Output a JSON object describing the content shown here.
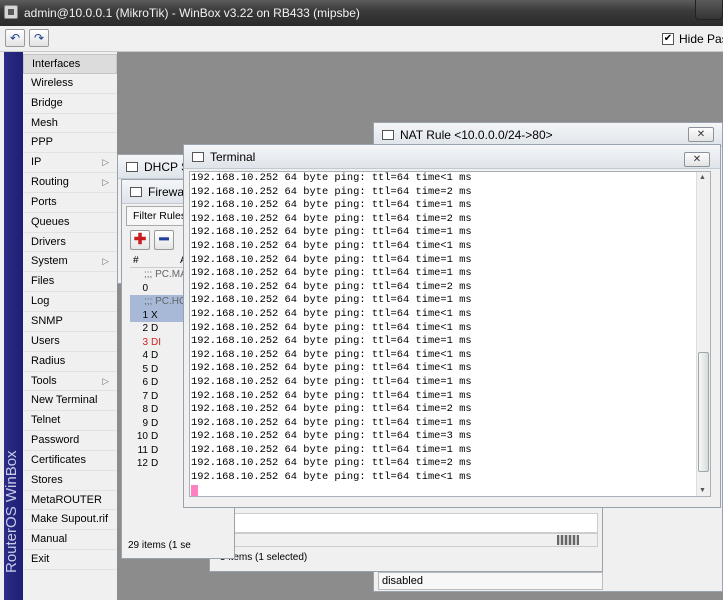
{
  "window": {
    "title": "admin@10.0.0.1 (MikroTik) - WinBox v3.22 on RB433 (mipsbe)"
  },
  "toolbar": {
    "undo_icon": "undo-icon",
    "redo_icon": "redo-icon",
    "hide_passwords_label": "Hide Passw",
    "hide_passwords_checked": true
  },
  "sidebar": {
    "brand": "RouterOS WinBox",
    "items": [
      {
        "label": "Interfaces",
        "submenu": false
      },
      {
        "label": "Wireless",
        "submenu": false
      },
      {
        "label": "Bridge",
        "submenu": false
      },
      {
        "label": "Mesh",
        "submenu": false
      },
      {
        "label": "PPP",
        "submenu": false
      },
      {
        "label": "IP",
        "submenu": true
      },
      {
        "label": "Routing",
        "submenu": true
      },
      {
        "label": "Ports",
        "submenu": false
      },
      {
        "label": "Queues",
        "submenu": false
      },
      {
        "label": "Drivers",
        "submenu": false
      },
      {
        "label": "System",
        "submenu": true
      },
      {
        "label": "Files",
        "submenu": false
      },
      {
        "label": "Log",
        "submenu": false
      },
      {
        "label": "SNMP",
        "submenu": false
      },
      {
        "label": "Users",
        "submenu": false
      },
      {
        "label": "Radius",
        "submenu": false
      },
      {
        "label": "Tools",
        "submenu": true
      },
      {
        "label": "New Terminal",
        "submenu": false
      },
      {
        "label": "Telnet",
        "submenu": false
      },
      {
        "label": "Password",
        "submenu": false
      },
      {
        "label": "Certificates",
        "submenu": false
      },
      {
        "label": "Stores",
        "submenu": false
      },
      {
        "label": "MetaROUTER",
        "submenu": false
      },
      {
        "label": "Make Supout.rif",
        "submenu": false
      },
      {
        "label": "Manual",
        "submenu": false
      },
      {
        "label": "Exit",
        "submenu": false
      }
    ]
  },
  "dhcp_window": {
    "title": "DHCP S"
  },
  "nat_window": {
    "title": "NAT Rule <10.0.0.0/24->80>",
    "status_text": "disabled",
    "items_count": "5 items (1 selected)"
  },
  "firewall_window": {
    "title": "Firewall",
    "tab": "Filter Rules",
    "col_num": "#",
    "col_action": "A",
    "rows": [
      {
        "num": "",
        "flag": ";;; PC.MA",
        "comment": true
      },
      {
        "num": "0",
        "flag": "",
        "comment": false
      },
      {
        "num": "",
        "flag": ";;; PC.HO",
        "comment": true
      },
      {
        "num": "1",
        "flag": "X",
        "comment": false
      },
      {
        "num": "2",
        "flag": "D",
        "comment": false
      },
      {
        "num": "3",
        "flag": "DI",
        "comment": false
      },
      {
        "num": "4",
        "flag": "D",
        "comment": false
      },
      {
        "num": "5",
        "flag": "D",
        "comment": false
      },
      {
        "num": "6",
        "flag": "D",
        "comment": false
      },
      {
        "num": "7",
        "flag": "D",
        "comment": false
      },
      {
        "num": "8",
        "flag": "D",
        "comment": false
      },
      {
        "num": "9",
        "flag": "D",
        "comment": false
      },
      {
        "num": "10",
        "flag": "D",
        "comment": false
      },
      {
        "num": "11",
        "flag": "D",
        "comment": false
      },
      {
        "num": "12",
        "flag": "D",
        "comment": false
      }
    ],
    "items_count": "29 items (1 se"
  },
  "terminal": {
    "title": "Terminal",
    "lines": [
      "192.168.10.252 64 byte ping: ttl=64 time<1 ms",
      "192.168.10.252 64 byte ping: ttl=64 time=2 ms",
      "192.168.10.252 64 byte ping: ttl=64 time=1 ms",
      "192.168.10.252 64 byte ping: ttl=64 time=2 ms",
      "192.168.10.252 64 byte ping: ttl=64 time=1 ms",
      "192.168.10.252 64 byte ping: ttl=64 time<1 ms",
      "192.168.10.252 64 byte ping: ttl=64 time=1 ms",
      "192.168.10.252 64 byte ping: ttl=64 time=1 ms",
      "192.168.10.252 64 byte ping: ttl=64 time=2 ms",
      "192.168.10.252 64 byte ping: ttl=64 time=1 ms",
      "192.168.10.252 64 byte ping: ttl=64 time<1 ms",
      "192.168.10.252 64 byte ping: ttl=64 time<1 ms",
      "192.168.10.252 64 byte ping: ttl=64 time=1 ms",
      "192.168.10.252 64 byte ping: ttl=64 time<1 ms",
      "192.168.10.252 64 byte ping: ttl=64 time<1 ms",
      "192.168.10.252 64 byte ping: ttl=64 time=1 ms",
      "192.168.10.252 64 byte ping: ttl=64 time=1 ms",
      "192.168.10.252 64 byte ping: ttl=64 time=2 ms",
      "192.168.10.252 64 byte ping: ttl=64 time=1 ms",
      "192.168.10.252 64 byte ping: ttl=64 time=3 ms",
      "192.168.10.252 64 byte ping: ttl=64 time=1 ms",
      "192.168.10.252 64 byte ping: ttl=64 time=2 ms",
      "192.168.10.252 64 byte ping: ttl=64 time<1 ms"
    ]
  }
}
